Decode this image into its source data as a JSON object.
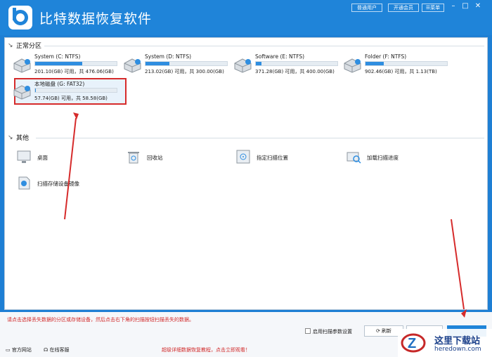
{
  "app": {
    "title": "比特数据恢复软件",
    "user_label": "普通用户",
    "vip_label": "开通会员",
    "menu_label": "菜单"
  },
  "sections": {
    "partitions_title": "正常分区",
    "other_title": "其他"
  },
  "drives": [
    {
      "name": "System (C: NTFS)",
      "size": "201.10(GB) 可用，共 476.06(GB)",
      "used_fraction": 0.58
    },
    {
      "name": "System (D: NTFS)",
      "size": "213.02(GB) 可用，共 300.00(GB)",
      "used_fraction": 0.29
    },
    {
      "name": "Software (E: NTFS)",
      "size": "371.28(GB) 可用，共 400.00(GB)",
      "used_fraction": 0.07
    },
    {
      "name": "Folder (F: NTFS)",
      "size": "902.46(GB) 可用，共 1.13(TB)",
      "used_fraction": 0.22
    },
    {
      "name": "本地磁盘 (G: FAT32)",
      "size": "57.74(GB) 可用，共 58.58(GB)",
      "used_fraction": 0.01
    }
  ],
  "other_items": [
    {
      "label": "桌面",
      "icon": "desktop-icon"
    },
    {
      "label": "回收站",
      "icon": "recycle-bin-icon"
    },
    {
      "label": "指定扫描位置",
      "icon": "target-location-icon"
    },
    {
      "label": "加载扫描进度",
      "icon": "load-progress-icon"
    },
    {
      "label": "扫描存储设备镜像",
      "icon": "disk-image-icon"
    }
  ],
  "bottom": {
    "hint": "请点击选择丢失数据的分区或存储设备，然后点击右下角的扫描按钮扫描丢失的数据。",
    "enable_scan_settings": "启用扫描参数设置",
    "refresh_label": "刷新"
  },
  "footer": {
    "official_site": "官方网站",
    "online_support": "在线客服",
    "tutorial_link": "超级详细数据恢复教程，点击立即观看！"
  },
  "watermark": {
    "brand": "这里下载站",
    "url": "heredown.com"
  },
  "colors": {
    "accent": "#1f84d9",
    "selection": "#d62b2b",
    "hint": "#d12a2a"
  }
}
